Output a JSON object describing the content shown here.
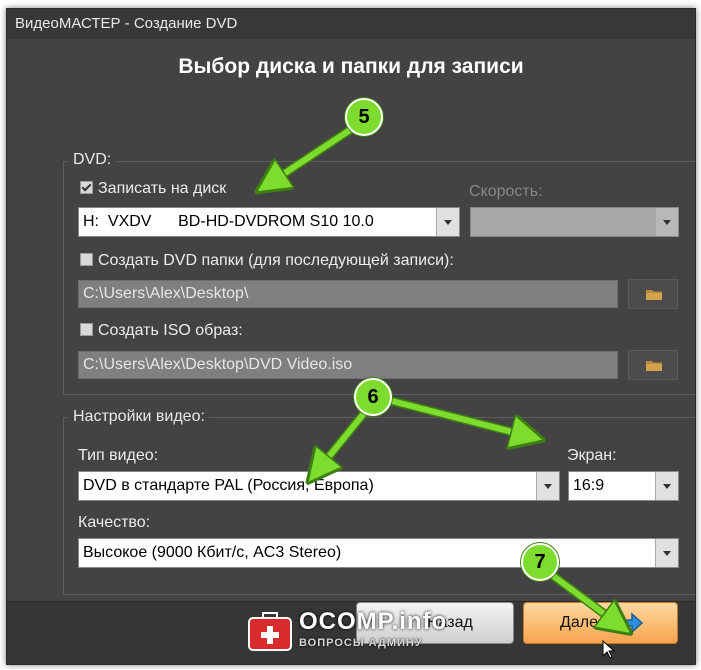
{
  "window": {
    "title": "ВидеоМАСТЕР - Создание DVD"
  },
  "heading": "Выбор диска и папки для записи",
  "dvd_group": {
    "label": "DVD:",
    "write_disc": {
      "label": "Записать на диск",
      "checked": true
    },
    "drive_select": {
      "value": "H:  VXDV      BD-HD-DVDROM S10 10.0"
    },
    "speed_label": "Скорость:",
    "speed_select": {
      "value": ""
    },
    "dvd_folder": {
      "label": "Создать DVD папки (для последующей записи):",
      "checked": false
    },
    "dvd_folder_path": "C:\\Users\\Alex\\Desktop\\",
    "iso_image": {
      "label": "Создать ISO образ:",
      "checked": false
    },
    "iso_path": "C:\\Users\\Alex\\Desktop\\DVD Video.iso"
  },
  "video_group": {
    "label": "Настройки видео:",
    "video_type_label": "Тип видео:",
    "video_type_value": "DVD в стандарте PAL (Россия, Европа)",
    "screen_label": "Экран:",
    "screen_value": "16:9",
    "quality_label": "Качество:",
    "quality_value": "Высокое (9000 Кбит/с, AC3 Stereo)"
  },
  "buttons": {
    "back": "Назад",
    "next": "Далее"
  },
  "annotations": {
    "badge_5": "5",
    "badge_6": "6",
    "badge_7": "7"
  },
  "watermark": {
    "title": "OCOMP.info",
    "subtitle": "ВОПРОСЫ АДМИНУ"
  },
  "colors": {
    "accent_green": "#7ddc2e",
    "next_button": "#f6a44c",
    "window_bg": "#434343"
  }
}
